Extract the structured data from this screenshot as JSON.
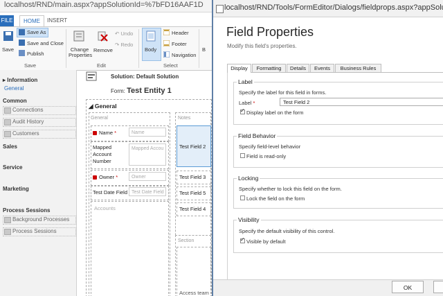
{
  "background_window": {
    "address_bar": "localhost/RND/main.aspx?appSolutionId=%7bFD16AAF1D",
    "ribbon": {
      "tabs": {
        "file": "FILE",
        "home": "HOME",
        "insert": "INSERT"
      },
      "save": "Save",
      "save_as": "Save As",
      "save_and_close": "Save and Close",
      "publish": "Publish",
      "change_properties": "Change Properties",
      "remove": "Remove",
      "undo": "Undo",
      "redo": "Redo",
      "body": "Body",
      "header": "Header",
      "footer": "Footer",
      "navigation": "Navigation",
      "more": "B",
      "groups": {
        "save": "Save",
        "edit": "Edit",
        "select": "Select"
      }
    },
    "nav": {
      "information": "Information",
      "general": "General",
      "common": "Common",
      "connections": "Connections",
      "audit_history": "Audit History",
      "customers": "Customers",
      "sales": "Sales",
      "service": "Service",
      "marketing": "Marketing",
      "process_sessions_header": "Process Sessions",
      "background_processes": "Background Processes",
      "process_sessions": "Process Sessions"
    },
    "solution": "Solution: Default Solution",
    "form_prefix": "Form:",
    "form_name": "Test Entity 1",
    "section_header": "General",
    "col_general": "General",
    "col_notes": "Notes",
    "fields": {
      "name_label": "Name",
      "name_placeholder": "Name",
      "mapped_label": "Mapped Account Number",
      "mapped_placeholder": "Mapped Accou",
      "owner_label": "Owner",
      "owner_placeholder": "Owner",
      "test_date_label": "Test Date Field",
      "test_date_placeholder": "Test Date Field",
      "accounts_placeholder": "Accounts",
      "test_field_2": "Test Field 2",
      "test_field_3": "Test Field 3",
      "test_field_5": "Test Field 5",
      "test_field_4": "Test Field 4",
      "section_label": "Section",
      "access_team": "Access team"
    }
  },
  "dialog": {
    "address_bar": "localhost/RND/Tools/FormEditor/Dialogs/fieldprops.aspx?appSolutio",
    "title": "Field Properties",
    "subtitle": "Modify this field's properties.",
    "tabs": [
      "Display",
      "Formatting",
      "Details",
      "Events",
      "Business Rules"
    ],
    "label_section": {
      "legend": "Label",
      "description": "Specify the label for this field in forms.",
      "label_caption": "Label",
      "label_value": "Test Field 2",
      "display_label": "Display label on the form",
      "display_label_checked": true
    },
    "behavior_section": {
      "legend": "Field Behavior",
      "description": "Specify field-level behavior",
      "read_only": "Field is read-only",
      "read_only_checked": false
    },
    "locking_section": {
      "legend": "Locking",
      "description": "Specify whether to lock this field on the form.",
      "lock": "Lock the field on the form",
      "lock_checked": false
    },
    "visibility_section": {
      "legend": "Visibility",
      "description": "Specify the default visibility of this control.",
      "visible": "Visible by default",
      "visible_checked": true
    },
    "ok": "OK"
  }
}
